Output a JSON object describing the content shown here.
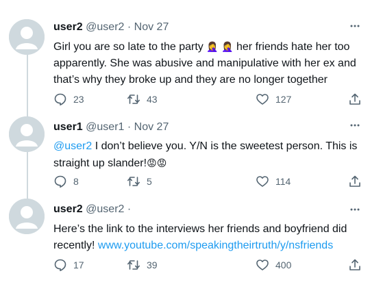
{
  "tweets": [
    {
      "name": "user2",
      "handle": "@user2",
      "separator": "·",
      "time": "Nov 27",
      "text_part1": "Girl you are so late to the party ",
      "emoji1": "🤦‍♀️",
      "emoji2": "🤦‍♀️",
      "text_part2": " her friends hate her too apparently. She was abusive and manipulative with her ex and that’s why they broke up and they are no longer together",
      "replies": "23",
      "retweets": "43",
      "likes": "127"
    },
    {
      "name": "user1",
      "handle": "@user1",
      "separator": "·",
      "time": "Nov 27",
      "mention": "@user2",
      "text": " I don’t believe you. Y/N is the sweetest person. This is straight up slander!",
      "emoji1": "😡",
      "emoji2": "😡",
      "replies": "8",
      "retweets": "5",
      "likes": "114"
    },
    {
      "name": "user2",
      "handle": "@user2",
      "separator": "·",
      "text": "Here’s the link to the interviews her friends and boyfriend did recently! ",
      "link": "www.youtube.com/speakingtheirtruth/y/nsfriends",
      "replies": "17",
      "retweets": "39",
      "likes": "400"
    }
  ],
  "icons": {
    "avatar": "default-avatar-icon",
    "more": "more-options-icon",
    "reply": "reply-icon",
    "retweet": "retweet-icon",
    "like": "heart-icon",
    "share": "share-icon"
  },
  "colors": {
    "text": "#0f1419",
    "secondary": "#536471",
    "link": "#1d9bf0",
    "avatar_bg": "#cfd9de"
  }
}
